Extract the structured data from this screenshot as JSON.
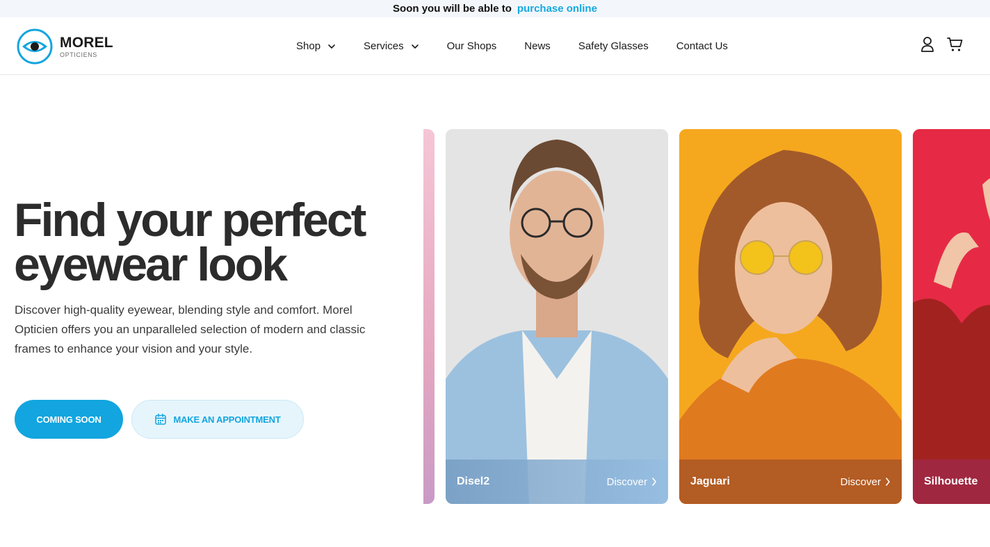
{
  "announcement": {
    "text": "Soon you will be able to",
    "link": "purchase online"
  },
  "brand": {
    "name": "MOREL",
    "subtitle": "OPTICIENS",
    "accent_color": "#12a5df"
  },
  "nav": {
    "items": [
      {
        "label": "Shop",
        "has_dropdown": true
      },
      {
        "label": "Services",
        "has_dropdown": true
      },
      {
        "label": "Our Shops",
        "has_dropdown": false
      },
      {
        "label": "News",
        "has_dropdown": false
      },
      {
        "label": "Safety Glasses",
        "has_dropdown": false
      },
      {
        "label": "Contact Us",
        "has_dropdown": false
      }
    ]
  },
  "header_icons": [
    "user-icon",
    "cart-icon"
  ],
  "hero": {
    "title_line1": "Find your perfect",
    "title_line2": "eyewear look",
    "description": "Discover high-quality eyewear, blending style and comfort. Morel Opticien offers you an unparalleled selection of modern and classic frames to enhance your vision and your style.",
    "primary_button": "COMING SOON",
    "secondary_button": "MAKE AN APPOINTMENT"
  },
  "carousel": {
    "cards": [
      {
        "name": "Disel2",
        "action": "Discover"
      },
      {
        "name": "Jaguari",
        "action": "Discover"
      },
      {
        "name": "Silhouette",
        "action": ""
      }
    ]
  }
}
